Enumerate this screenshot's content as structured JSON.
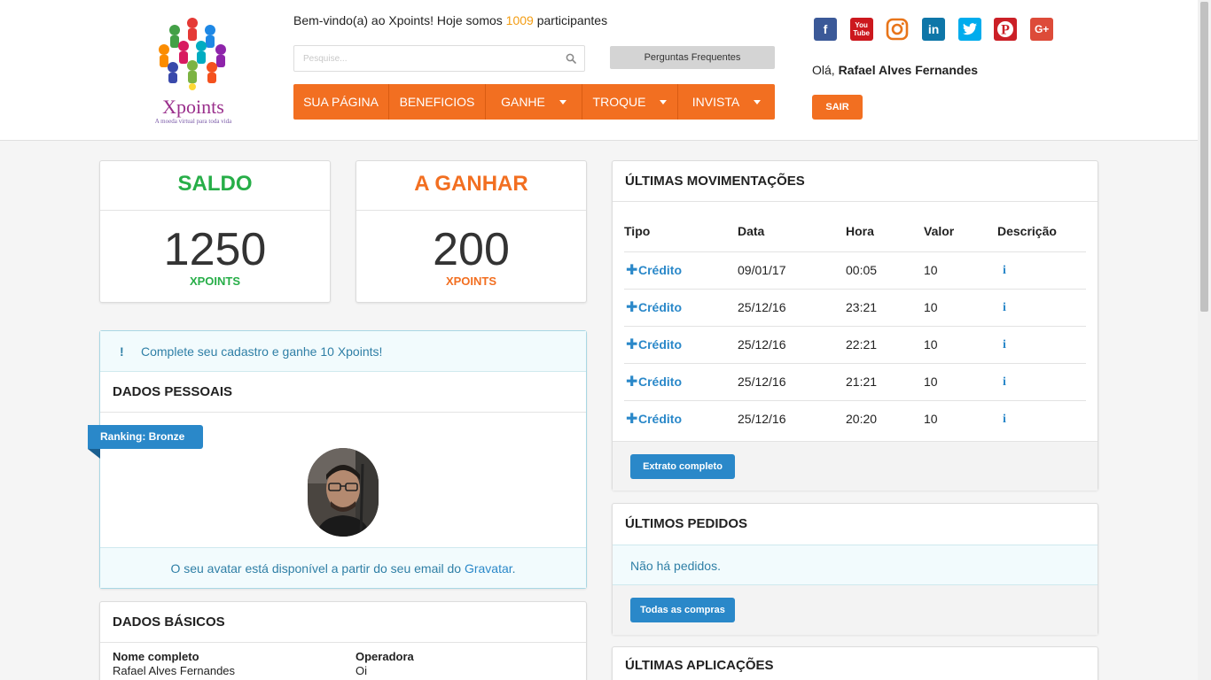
{
  "header": {
    "logo": {
      "name": "Xpoints",
      "tagline": "A moeda virtual para toda vida"
    },
    "welcome": {
      "before": "Bem-vindo(a) ao Xpoints! Hoje somos ",
      "count": "1009",
      "after": " participantes"
    },
    "search": {
      "placeholder": "Pesquise...",
      "value": "",
      "icon": "search-icon"
    },
    "faq_label": "Perguntas Frequentes",
    "nav": [
      {
        "label": "SUA PÁGINA",
        "dropdown": false
      },
      {
        "label": "BENEFICIOS",
        "dropdown": false
      },
      {
        "label": "GANHE",
        "dropdown": true
      },
      {
        "label": "TROQUE",
        "dropdown": true
      },
      {
        "label": "INVISTA",
        "dropdown": true
      }
    ],
    "socials": [
      "facebook-icon",
      "youtube-icon",
      "instagram-icon",
      "linkedin-icon",
      "twitter-icon",
      "pinterest-icon",
      "google-plus-icon"
    ],
    "youtube_text": {
      "top": "You",
      "bottom": "Tube"
    },
    "hello": {
      "prefix": "Olá, ",
      "name": "Rafael Alves Fernandes"
    },
    "logout_label": "SAIR"
  },
  "balance": {
    "title": "SALDO",
    "value": "1250",
    "unit": "XPOINTS",
    "color": "#27ae48"
  },
  "to_earn": {
    "title": "A GANHAR",
    "value": "200",
    "unit": "XPOINTS",
    "color": "#f26f21"
  },
  "profile": {
    "alert": {
      "icon": "exclamation-icon",
      "symbol": "!",
      "text": "Complete seu cadastro e ganhe 10 Xpoints!"
    },
    "heading": "DADOS PESSOAIS",
    "ranking": "Ranking: Bronze",
    "avatar_note": {
      "before": "O seu avatar está disponível a partir do seu email do ",
      "link": "Gravatar",
      "after": "."
    }
  },
  "basic": {
    "heading": "DADOS BÁSICOS",
    "fields": [
      {
        "label": "Nome completo",
        "value": "Rafael Alves Fernandes"
      },
      {
        "label": "Operadora",
        "value": "Oi"
      }
    ]
  },
  "movements": {
    "heading": "ÚLTIMAS MOVIMENTAÇÕES",
    "columns": [
      "Tipo",
      "Data",
      "Hora",
      "Valor",
      "Descrição"
    ],
    "rows": [
      {
        "tipo": "Crédito",
        "data": "09/01/17",
        "hora": "00:05",
        "valor": "10"
      },
      {
        "tipo": "Crédito",
        "data": "25/12/16",
        "hora": "23:21",
        "valor": "10"
      },
      {
        "tipo": "Crédito",
        "data": "25/12/16",
        "hora": "22:21",
        "valor": "10"
      },
      {
        "tipo": "Crédito",
        "data": "25/12/16",
        "hora": "21:21",
        "valor": "10"
      },
      {
        "tipo": "Crédito",
        "data": "25/12/16",
        "hora": "20:20",
        "valor": "10"
      }
    ],
    "plus_symbol": "✚",
    "info_symbol": "i",
    "button": "Extrato completo"
  },
  "orders": {
    "heading": "ÚLTIMOS PEDIDOS",
    "empty": "Não há pedidos.",
    "button": "Todas as compras"
  },
  "apps": {
    "heading": "ÚLTIMAS APLICAÇÕES"
  },
  "colors": {
    "accent": "#f26f21",
    "primary": "#2a88c9",
    "success": "#27ae48",
    "highlight": "#f39c12"
  }
}
